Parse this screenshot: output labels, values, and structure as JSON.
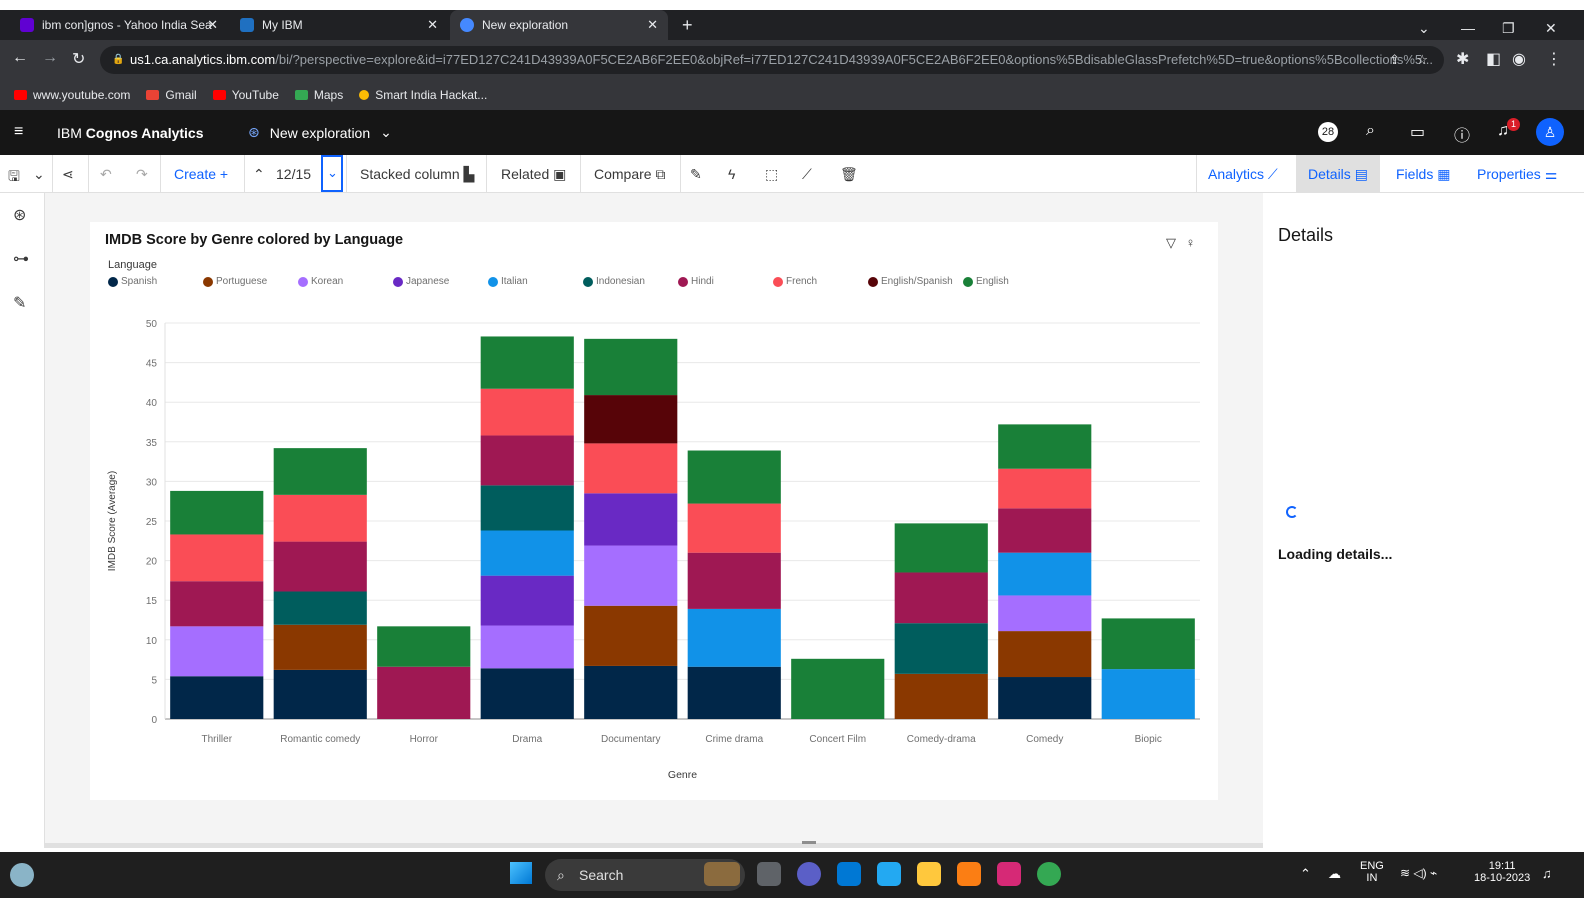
{
  "browser": {
    "tabs": [
      {
        "title": "ibm con]gnos - Yahoo India Sea",
        "favicon_color": "#6001d2"
      },
      {
        "title": "My IBM",
        "favicon_color": "#1f70c1"
      },
      {
        "title": "New exploration",
        "favicon_color": "#4589ff"
      }
    ],
    "new_tab_glyph": "+",
    "url_host": "us1.ca.analytics.ibm.com",
    "url_path": "/bi/?perspective=explore&id=i77ED127C241D43939A0F5CE2AB6F2EE0&objRef=i77ED127C241D43939A0F5CE2AB6F2EE0&options%5BdisableGlassPrefetch%5D=true&options%5Bcollections%5...",
    "bookmarks": [
      {
        "label": "www.youtube.com",
        "color": "#ff0000"
      },
      {
        "label": "Gmail",
        "color": "#ea4335"
      },
      {
        "label": "YouTube",
        "color": "#ff0000"
      },
      {
        "label": "Maps",
        "color": "#34a853"
      },
      {
        "label": "Smart India Hackat...",
        "color": "#fbbc04"
      }
    ]
  },
  "app": {
    "brand_light": "IBM",
    "brand_bold": "Cognos Analytics",
    "exploration_title": "New exploration",
    "avatar_badge": "28",
    "notification_count": "1"
  },
  "toolbar": {
    "create_label": "Create",
    "create_glyph": "+",
    "pager": "12/15",
    "stacked_label": "Stacked column",
    "related_label": "Related",
    "compare_label": "Compare",
    "right_tabs": [
      {
        "label": "Analytics"
      },
      {
        "label": "Details"
      },
      {
        "label": "Fields"
      },
      {
        "label": "Properties"
      }
    ]
  },
  "details": {
    "title": "Details",
    "loading": "Loading details..."
  },
  "taskbar": {
    "search_label": "Search",
    "lang": "ENG",
    "region": "IN",
    "time": "19:11",
    "date": "18-10-2023"
  },
  "chart_data": {
    "type": "bar",
    "stacked": true,
    "title": "IMDB Score by Genre colored by Language",
    "legend_title": "Language",
    "xlabel": "Genre",
    "ylabel": "IMDB Score (Average)",
    "ylim": [
      0,
      50
    ],
    "yticks": [
      0,
      5,
      10,
      15,
      20,
      25,
      30,
      35,
      40,
      45,
      50
    ],
    "grid": true,
    "legend_position": "top-left",
    "categories": [
      "Thriller",
      "Romantic comedy",
      "Horror",
      "Drama",
      "Documentary",
      "Crime drama",
      "Concert Film",
      "Comedy-drama",
      "Comedy",
      "Biopic"
    ],
    "series": [
      {
        "name": "Spanish",
        "color": "#012749",
        "values": [
          5.4,
          6.2,
          0,
          6.4,
          6.7,
          6.6,
          0,
          0,
          5.3,
          0
        ]
      },
      {
        "name": "Portuguese",
        "color": "#8a3800",
        "values": [
          0,
          5.7,
          0,
          0,
          7.6,
          0,
          0,
          5.7,
          5.8,
          0
        ]
      },
      {
        "name": "Korean",
        "color": "#a56eff",
        "values": [
          6.3,
          0,
          0,
          5.4,
          7.6,
          0,
          0,
          0,
          4.5,
          0
        ]
      },
      {
        "name": "Japanese",
        "color": "#6929c4",
        "values": [
          0,
          0,
          0,
          6.3,
          6.6,
          0,
          0,
          0,
          0,
          0
        ]
      },
      {
        "name": "Italian",
        "color": "#1192e8",
        "values": [
          0,
          0,
          0,
          5.7,
          0,
          7.3,
          0,
          0,
          5.4,
          6.3
        ]
      },
      {
        "name": "Indonesian",
        "color": "#005d5d",
        "values": [
          0,
          4.2,
          0,
          5.7,
          0,
          0,
          0,
          6.4,
          0,
          0
        ]
      },
      {
        "name": "Hindi",
        "color": "#9f1853",
        "values": [
          5.7,
          6.3,
          6.6,
          6.3,
          0,
          7.1,
          0,
          6.4,
          5.6,
          0
        ]
      },
      {
        "name": "French",
        "color": "#fa4d56",
        "values": [
          5.9,
          5.9,
          0,
          5.9,
          6.3,
          6.2,
          0,
          0,
          5.0,
          0
        ]
      },
      {
        "name": "English/Spanish",
        "color": "#570408",
        "values": [
          0,
          0,
          0,
          0,
          6.1,
          0,
          0,
          0,
          0,
          0
        ]
      },
      {
        "name": "English",
        "color": "#198038",
        "values": [
          5.5,
          5.9,
          5.1,
          6.6,
          7.1,
          6.7,
          7.6,
          6.2,
          5.6,
          6.4
        ]
      }
    ]
  }
}
